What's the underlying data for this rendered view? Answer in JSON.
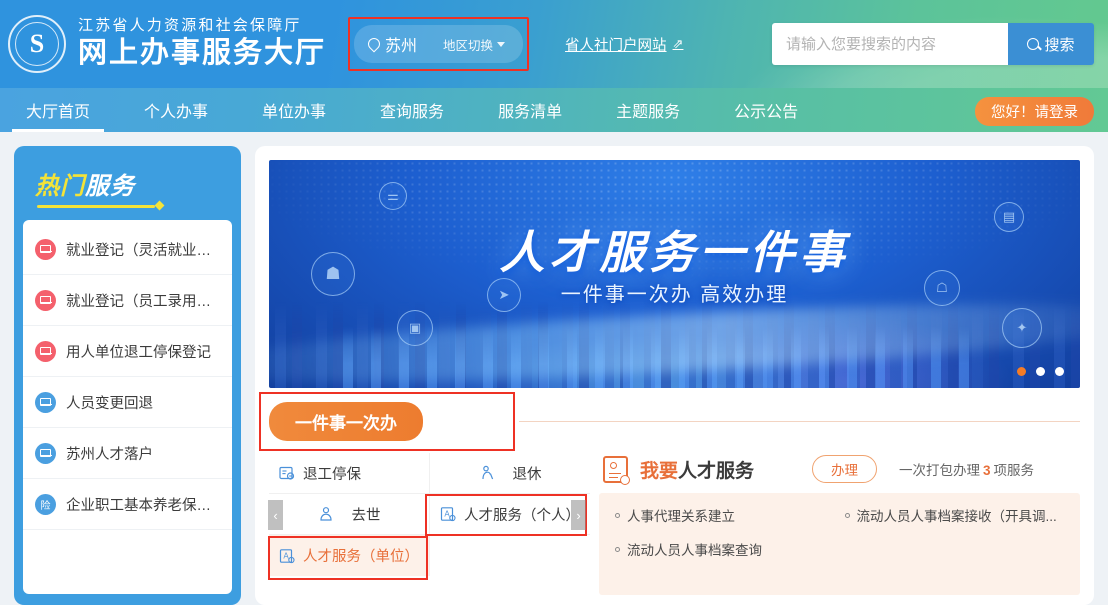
{
  "header": {
    "logo_alt": "江苏省人力资源和社会保障厅徽标",
    "org_name": "江苏省人力资源和社会保障厅",
    "site_name": "网上办事服务大厅",
    "region": {
      "city": "苏州",
      "switch_label": "地区切换"
    },
    "portal_link": "省人社门户网站",
    "search": {
      "placeholder": "请输入您要搜索的内容",
      "value": "",
      "button_label": "搜索"
    },
    "accent_blue": "#3b8fd4",
    "accent_green": "#62c994"
  },
  "nav": {
    "items": [
      {
        "label": "大厅首页",
        "active": true
      },
      {
        "label": "个人办事",
        "active": false
      },
      {
        "label": "单位办事",
        "active": false
      },
      {
        "label": "查询服务",
        "active": false
      },
      {
        "label": "服务清单",
        "active": false
      },
      {
        "label": "主题服务",
        "active": false
      },
      {
        "label": "公示公告",
        "active": false
      }
    ],
    "login_label": "您好！请登录",
    "login_color": "#f0813c"
  },
  "sidebar": {
    "title_part1": "热门",
    "title_part2": "服务",
    "title_color": "#f4e338",
    "items": [
      {
        "label": "就业登记（灵活就业）...",
        "icon": "envelope-icon",
        "color": "red"
      },
      {
        "label": "就业登记（员工录用）...",
        "icon": "envelope-icon",
        "color": "red"
      },
      {
        "label": "用人单位退工停保登记",
        "icon": "envelope-icon",
        "color": "red"
      },
      {
        "label": "人员变更回退",
        "icon": "envelope-icon",
        "color": "blue"
      },
      {
        "label": "苏州人才落户",
        "icon": "envelope-icon",
        "color": "blue"
      },
      {
        "label": "企业职工基本养老保险...",
        "icon": "insurance-icon",
        "color": "blue"
      }
    ]
  },
  "banner": {
    "title": "人才服务一件事",
    "subtitle": "一件事一次办 高效办理",
    "dots": [
      {
        "active": true
      },
      {
        "active": false
      },
      {
        "active": false
      }
    ],
    "floating_icons": [
      {
        "name": "users-icon",
        "glyph": "⚌"
      },
      {
        "name": "briefcase-icon",
        "glyph": "❖"
      },
      {
        "name": "person-suit-icon",
        "glyph": "☗"
      },
      {
        "name": "document-icon",
        "glyph": "▤"
      },
      {
        "name": "mouse-pointer-icon",
        "glyph": "➤"
      },
      {
        "name": "graduate-icon",
        "glyph": "▣"
      },
      {
        "name": "person-group-icon",
        "glyph": "☖"
      },
      {
        "name": "handshake-icon",
        "glyph": "✦"
      }
    ]
  },
  "tabstrip": {
    "pill_label": "一件事一次办",
    "pill_color": "#ed7c2f"
  },
  "tabgrid": {
    "prev_arrow": "‹",
    "next_arrow": "›",
    "cells": [
      {
        "label": "退工停保",
        "icon": "id-card-icon",
        "active": false,
        "highlighted": false,
        "centered": false
      },
      {
        "label": "退休",
        "icon": "retiree-icon",
        "active": false,
        "highlighted": false,
        "centered": true
      },
      {
        "label": "去世",
        "icon": "person-icon",
        "active": false,
        "highlighted": false,
        "centered": true
      },
      {
        "label": "人才服务（个人）",
        "icon": "talent-card-icon",
        "active": false,
        "highlighted": true,
        "centered": false
      },
      {
        "label": "人才服务（单位）",
        "icon": "talent-card-icon",
        "active": true,
        "highlighted": true,
        "centered": false
      }
    ]
  },
  "right_panel": {
    "title_prefix": "我要",
    "title_suffix": "人才服务",
    "action_label": "办理",
    "meta_prefix": "一次打包办理",
    "meta_count": "3",
    "meta_suffix": "项服务",
    "items": [
      {
        "label": "人事代理关系建立"
      },
      {
        "label": "流动人员人事档案接收（开具调..."
      },
      {
        "label": "流动人员人事档案查询"
      }
    ],
    "accent": "#e8703a",
    "bg": "#fdf1e9"
  }
}
